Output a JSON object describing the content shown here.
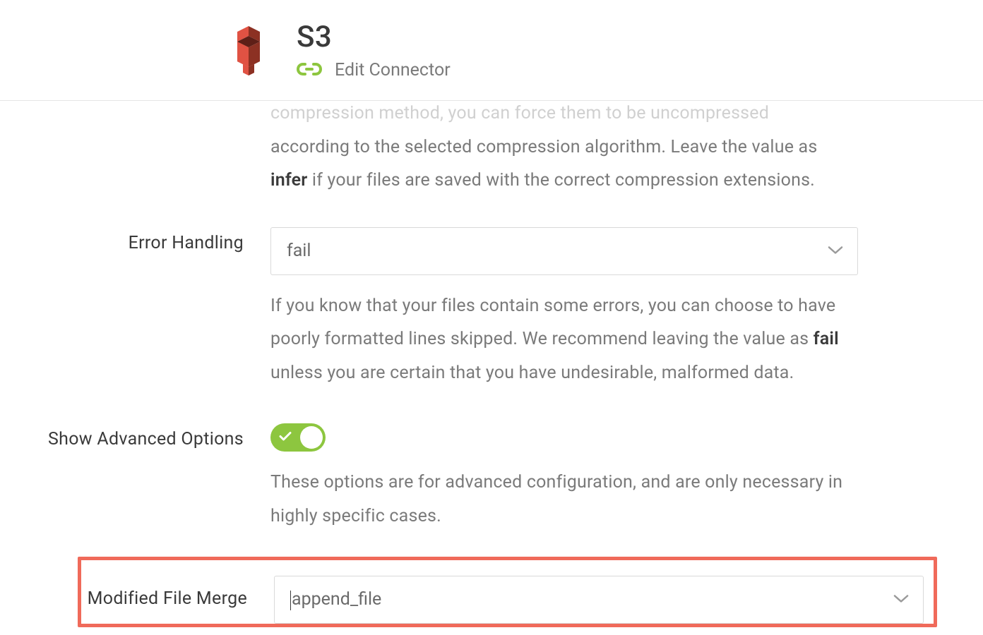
{
  "header": {
    "title": "S3",
    "subtitle": "Edit Connector"
  },
  "compression_section": {
    "partial_cut_line": "compression method, you can force them to be uncompressed",
    "partial_line2_a": "according to the selected compression algorithm. Leave the value as ",
    "partial_line2_bold": "infer",
    "partial_line2_b": " if your files are saved with the correct compression extensions."
  },
  "error_handling": {
    "label": "Error Handling",
    "value": "fail",
    "help_a": "If you know that your files contain some errors, you can choose to have poorly formatted lines skipped. We recommend leaving the value as ",
    "help_bold": "fail",
    "help_b": " unless you are certain that you have undesirable, malformed data."
  },
  "advanced": {
    "label": "Show Advanced Options",
    "help": "These options are for advanced configuration, and are only necessary in highly specific cases."
  },
  "modified_merge": {
    "label": "Modified File Merge",
    "value": "append_file"
  }
}
